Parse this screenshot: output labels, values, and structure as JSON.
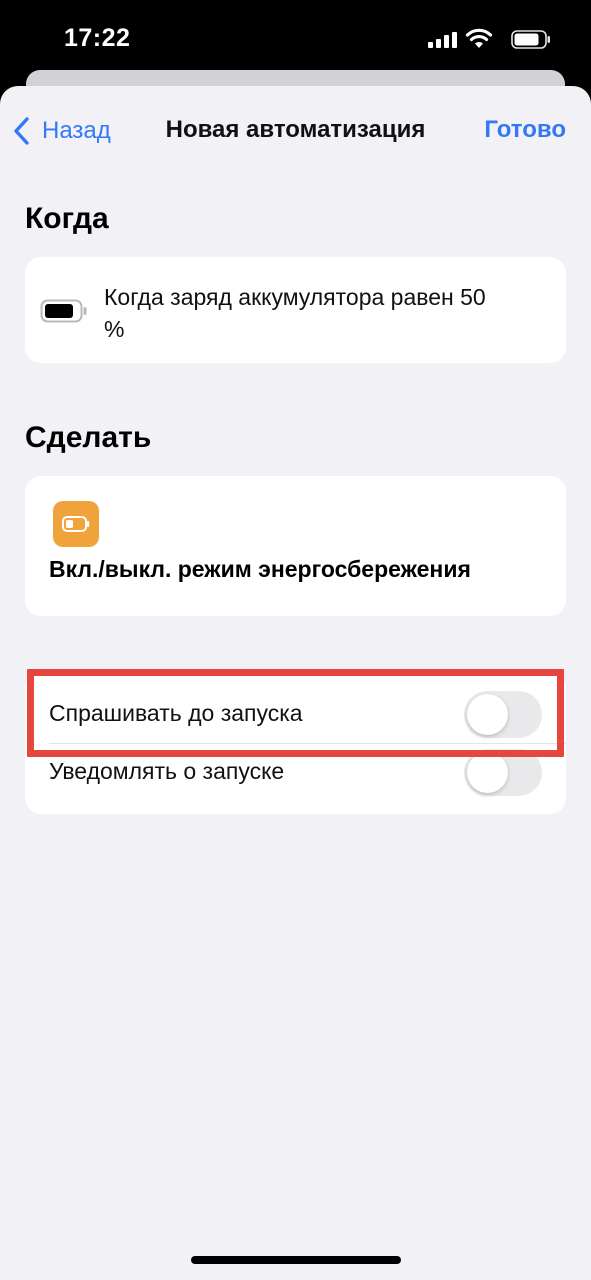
{
  "status_bar": {
    "time": "17:22",
    "icons": [
      "cellular-signal-icon",
      "wifi-icon",
      "battery-icon"
    ]
  },
  "nav": {
    "back_label": "Назад",
    "title": "Новая автоматизация",
    "done_label": "Готово"
  },
  "when": {
    "section_title": "Когда",
    "trigger_icon": "battery-icon",
    "trigger_text": "Когда заряд аккумулятора равен 50 %"
  },
  "do": {
    "section_title": "Сделать",
    "action_icon": "low-power-battery-icon",
    "action_label": "Вкл./выкл. режим энергосбережения"
  },
  "options": [
    {
      "label": "Спрашивать до запуска",
      "enabled": false,
      "highlighted": true
    },
    {
      "label": "Уведомлять о запуске",
      "enabled": false,
      "highlighted": false
    }
  ],
  "colors": {
    "accent": "#3478f6",
    "background": "#f2f1f6",
    "card": "#ffffff",
    "action_icon_bg": "#f0a33a",
    "highlight": "#e5473e",
    "switch_off": "#e9e9ec"
  }
}
